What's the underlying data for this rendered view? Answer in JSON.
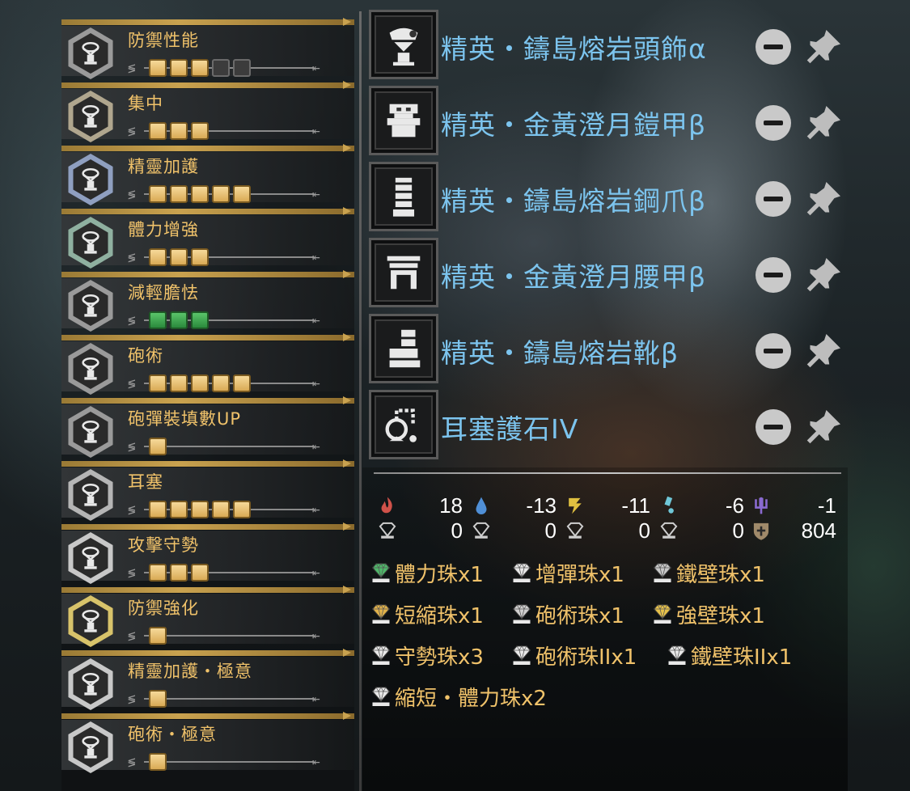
{
  "skills": [
    {
      "name": "防禦性能",
      "level": 3,
      "max": 5,
      "pip_style": "gold",
      "badge_color": "#9a9a9a"
    },
    {
      "name": "集中",
      "level": 3,
      "max": 3,
      "pip_style": "gold",
      "badge_color": "#b0a68e"
    },
    {
      "name": "精靈加護",
      "level": 5,
      "max": 5,
      "pip_style": "gold",
      "badge_color": "#8f9fc0"
    },
    {
      "name": "體力增強",
      "level": 3,
      "max": 3,
      "pip_style": "gold",
      "badge_color": "#8fb0a0"
    },
    {
      "name": "減輕膽怯",
      "level": 3,
      "max": 3,
      "pip_style": "green",
      "badge_color": "#9a9a9a"
    },
    {
      "name": "砲術",
      "level": 5,
      "max": 5,
      "pip_style": "gold",
      "badge_color": "#9a9a9a"
    },
    {
      "name": "砲彈裝填數UP",
      "level": 1,
      "max": 1,
      "pip_style": "gold",
      "badge_color": "#9a9a9a"
    },
    {
      "name": "耳塞",
      "level": 5,
      "max": 5,
      "pip_style": "gold",
      "badge_color": "#b5b5b5"
    },
    {
      "name": "攻擊守勢",
      "level": 3,
      "max": 3,
      "pip_style": "gold",
      "badge_color": "#c8c8c8"
    },
    {
      "name": "防禦強化",
      "level": 1,
      "max": 1,
      "pip_style": "gold",
      "badge_color": "#d8c36a"
    },
    {
      "name": "精靈加護・極意",
      "level": 1,
      "max": 1,
      "pip_style": "gold",
      "badge_color": "#c8c8c8"
    },
    {
      "name": "砲術・極意",
      "level": 1,
      "max": 1,
      "pip_style": "gold",
      "badge_color": "#c8c8c8"
    }
  ],
  "equipment": [
    {
      "name": "精英・鑄島熔岩頭飾α",
      "icon": "helm-icon"
    },
    {
      "name": "精英・金黃澄月鎧甲β",
      "icon": "chest-icon"
    },
    {
      "name": "精英・鑄島熔岩鋼爪β",
      "icon": "arms-icon"
    },
    {
      "name": "精英・金黃澄月腰甲β",
      "icon": "waist-icon"
    },
    {
      "name": "精英・鑄島熔岩靴β",
      "icon": "legs-icon"
    },
    {
      "name": "耳塞護石IV",
      "icon": "charm-icon"
    }
  ],
  "resistances": [
    {
      "element": "fire",
      "value": "18",
      "color": "#d0524a"
    },
    {
      "element": "water",
      "value": "-13",
      "color": "#4f8fd6"
    },
    {
      "element": "thunder",
      "value": "-11",
      "color": "#e0c040"
    },
    {
      "element": "ice",
      "value": "-6",
      "color": "#6fc7d8"
    },
    {
      "element": "dragon",
      "value": "-1",
      "color": "#8a6ad0"
    }
  ],
  "slots": [
    {
      "size": "1",
      "value": "0"
    },
    {
      "size": "2",
      "value": "0"
    },
    {
      "size": "3",
      "value": "0"
    },
    {
      "size": "4",
      "value": "0"
    },
    {
      "type": "defense",
      "value": "804"
    }
  ],
  "decorations": [
    {
      "label": "體力珠x1",
      "gem_color": "#4fb86a"
    },
    {
      "label": "增彈珠x1",
      "gem_color": "#e8e8e8"
    },
    {
      "label": "鐵壁珠x1",
      "gem_color": "#c8c8c8"
    },
    {
      "label": "短縮珠x1",
      "gem_color": "#e0b24a"
    },
    {
      "label": "砲術珠x1",
      "gem_color": "#d0d0d0"
    },
    {
      "label": "強壁珠x1",
      "gem_color": "#e6c14a"
    },
    {
      "label": "守勢珠x3",
      "gem_color": "#e8e8e8"
    },
    {
      "label": "砲術珠IIx1",
      "gem_color": "#e8e8e8"
    },
    {
      "label": "鐵壁珠IIx1",
      "gem_color": "#e8e8e8"
    },
    {
      "label": "縮短・體力珠x2",
      "gem_color": "#e8e8e8"
    }
  ],
  "colors": {
    "skill_name": "#f0c26a",
    "equipment_name": "#7cc4ee",
    "pip_gold": "#e8c070",
    "pip_green": "#3fa850"
  }
}
